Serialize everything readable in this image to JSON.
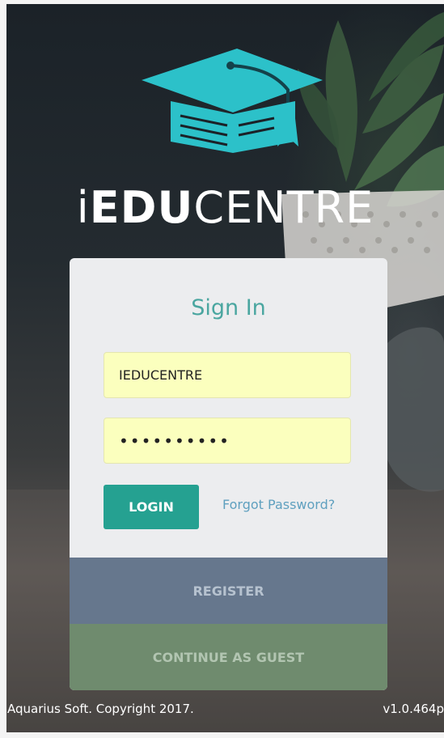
{
  "brand": {
    "prefix": "i",
    "bold": "EDU",
    "light": "CENTRE"
  },
  "sign_in": {
    "title": "Sign In",
    "username_value": "IEDUCENTRE",
    "password_value": "••••••••••",
    "login_label": "LOGIN",
    "forgot_label": "Forgot Password?"
  },
  "actions": {
    "register_label": "REGISTER",
    "guest_label": "CONTINUE AS GUEST"
  },
  "footer": {
    "copyright": "Aquarius Soft. Copyright 2017.",
    "version": "v1.0.464p"
  },
  "colors": {
    "accent": "#25a191",
    "logo": "#2cc1c9",
    "title": "#4aa6a0",
    "field_bg": "#fbffbe",
    "register_bg": "#66778d",
    "guest_bg": "#6f8b6e"
  },
  "icons": {
    "logo": "graduation-cap-book-icon"
  }
}
